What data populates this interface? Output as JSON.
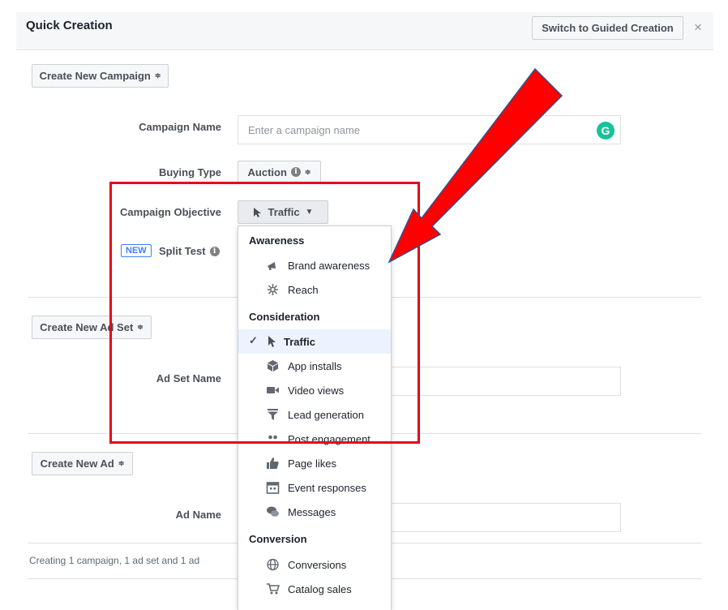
{
  "header": {
    "title": "Quick Creation",
    "guided_button": "Switch to Guided Creation",
    "close": "×"
  },
  "campaign": {
    "button": "Create New Campaign",
    "name_label": "Campaign Name",
    "name_placeholder": "Enter a campaign name",
    "grammarly": "G",
    "buying_type_label": "Buying Type",
    "buying_type_value": "Auction",
    "objective_label": "Campaign Objective",
    "objective_value": "Traffic",
    "new_badge": "NEW",
    "split_test_label": "Split Test"
  },
  "adset": {
    "button": "Create New Ad Set",
    "name_label": "Ad Set Name"
  },
  "ad": {
    "button": "Create New Ad",
    "name_label": "Ad Name"
  },
  "footer": {
    "summary": "Creating 1 campaign, 1 ad set and 1 ad"
  },
  "dropdown": {
    "awareness": "Awareness",
    "brand_awareness": "Brand awareness",
    "reach": "Reach",
    "consideration": "Consideration",
    "traffic": "Traffic",
    "app_installs": "App installs",
    "video_views": "Video views",
    "lead_generation": "Lead generation",
    "post_engagement": "Post engagement",
    "page_likes": "Page likes",
    "event_responses": "Event responses",
    "messages": "Messages",
    "conversion": "Conversion",
    "conversions": "Conversions",
    "catalog_sales": "Catalog sales",
    "check": "✓"
  },
  "icons": {
    "updown": "≑",
    "info": "i",
    "caret": "▼"
  },
  "colors": {
    "annotation_red": "#ff0000",
    "selected_bg": "#ecf3ff",
    "badge_blue": "#4080ff",
    "grammarly_green": "#15c39a"
  }
}
